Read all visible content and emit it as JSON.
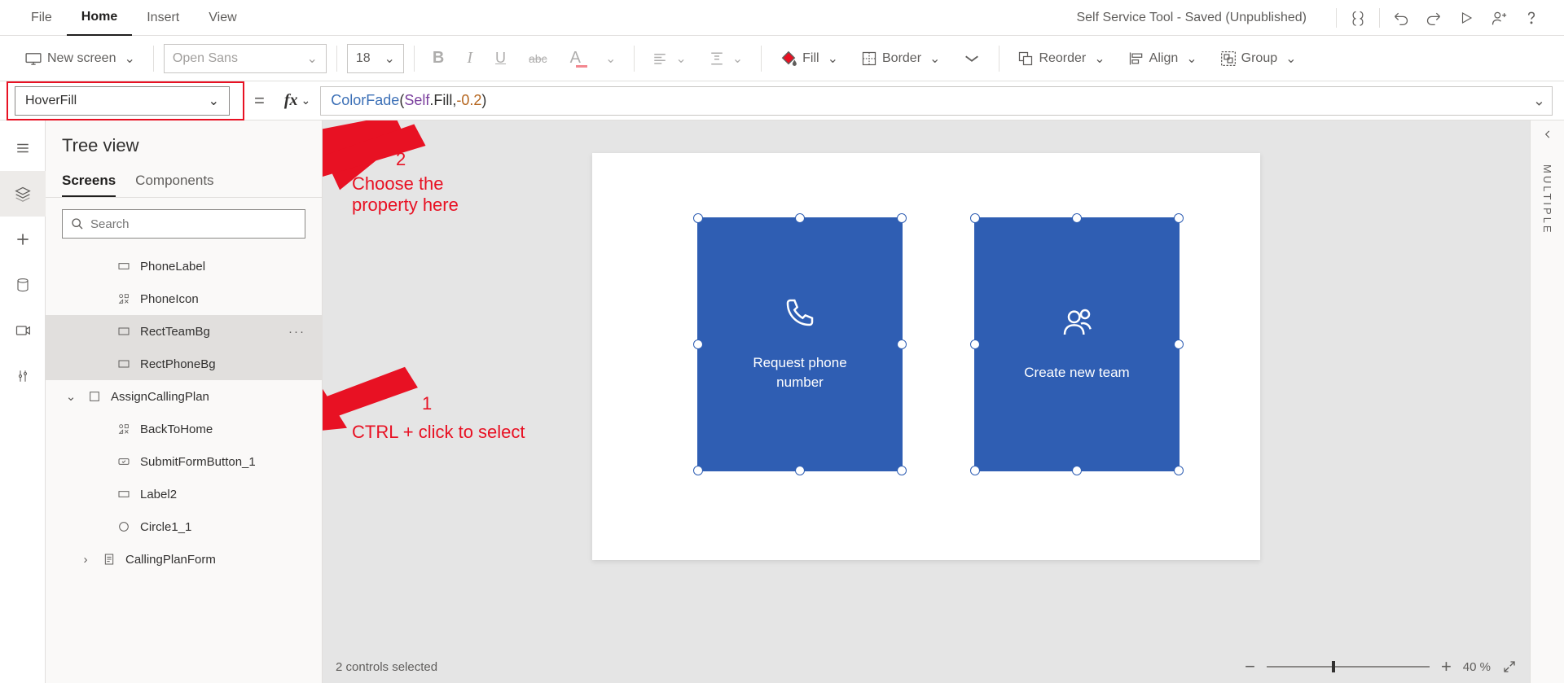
{
  "menubar": {
    "items": [
      {
        "label": "File"
      },
      {
        "label": "Home"
      },
      {
        "label": "Insert"
      },
      {
        "label": "View"
      }
    ],
    "app_title": "Self Service Tool - Saved (Unpublished)"
  },
  "ribbon": {
    "new_screen": "New screen",
    "font_name": "Open Sans",
    "font_size": "18",
    "fill": "Fill",
    "border": "Border",
    "reorder": "Reorder",
    "align": "Align",
    "group": "Group"
  },
  "property_selector": {
    "value": "HoverFill"
  },
  "formula": {
    "fn": "ColorFade",
    "arg1a": "Self",
    "arg1b": "Fill",
    "arg2": "-0.2"
  },
  "tree_view": {
    "title": "Tree view",
    "tabs": {
      "screens": "Screens",
      "components": "Components"
    },
    "search_placeholder": "Search",
    "items": [
      {
        "label": "PhoneLabel"
      },
      {
        "label": "PhoneIcon"
      },
      {
        "label": "RectTeamBg"
      },
      {
        "label": "RectPhoneBg"
      },
      {
        "label": "AssignCallingPlan"
      },
      {
        "label": "BackToHome"
      },
      {
        "label": "SubmitFormButton_1"
      },
      {
        "label": "Label2"
      },
      {
        "label": "Circle1_1"
      },
      {
        "label": "CallingPlanForm"
      }
    ]
  },
  "canvas": {
    "card_a": {
      "label": "Request phone\nnumber"
    },
    "card_b": {
      "label": "Create new team"
    }
  },
  "status": {
    "selection_text": "2 controls selected",
    "zoom_value": "40",
    "zoom_suffix": "%"
  },
  "right_panel": {
    "label": "MULTIPLE"
  },
  "annotations": {
    "step1_num": "1",
    "step1_text": "CTRL + click to select",
    "step2_num": "2",
    "step2_text": "Choose the\nproperty here"
  }
}
